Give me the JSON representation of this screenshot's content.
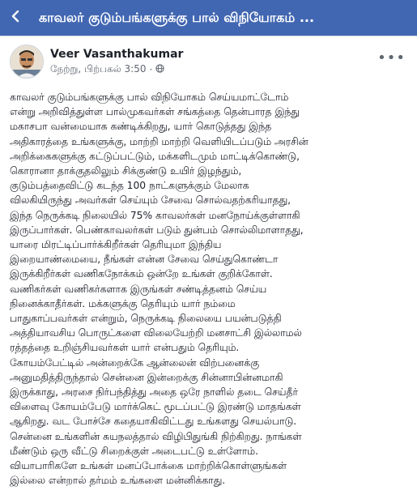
{
  "topbar": {
    "back_icon": "arrow-left-icon",
    "title": "காவலர் குடும்பங்களுக்கு பால் விநியோகம் ..."
  },
  "post": {
    "author": "Veer Vasanthakumar",
    "time": "நேற்று, பிற்பகல் 3:50",
    "separator": "·",
    "privacy_icon": "globe-icon",
    "more_icon": "more-dots-icon",
    "more_label": "•••",
    "lines": [
      "காவலர் குடும்பங்களுக்கு பால் விநியோகம் செய்யமாட்டோம்",
      "என்று அறிவித்துள்ள பால்முகவர்கள் சங்கத்தை தென்பாரத இந்து",
      "மகாசபா வன்மையாக கண்டிக்கிறது, யார் கொடுத்தது இந்த",
      "அதிகாரத்தை உங்களுக்கு, மாற்றி மாற்றி வெளியிடப்படும் அரசின்",
      "அறிக்கைகளுக்கு கட்டுப்பட்டும், மக்களிடமும் மாட்டிக்கொண்டு,",
      "கொரானா தாக்குதலிலும் சிக்குண்டு உயிர் இழந்தும்,",
      "குடும்பத்தைவிட்டு கடந்த 100 நாட்களுக்கும் மேலாக",
      "விலகியிருந்து அவர்கள் செய்யும் சேவை சொல்வதற்கரியாதது,",
      "இந்த நெருக்கடி நிலையில் 75% காவலர்கள் மனநோய்க்குள்ளாகி",
      "இருப்பார்கள். பெண்காவலர்கள் படும் துன்பம் சொல்லிமாளாதது,",
      "யாரை மிரட்டிப்பார்க்கிறீர்கள் தெரியுமா இந்திய",
      "இறையாண்மையை, நீங்கள் என்ன சேவை செய்துகொண்டா",
      "இருக்கிறீர்கள் வணிகநோக்கம் ஒன்றே உங்கள் குறிக்கோள்.",
      "வணிகர்கள் வணிகர்களாக இருங்கள் சண்டித்தனம் செய்ய",
      "நினைக்காதீர்கள். மக்களுக்கு தெரியும் யார் நம்மை",
      "பாதுகாப்பவர்கள் என்றும், நெருக்கடி நிலையை பயன்படுத்தி",
      "அத்தியாவசிய பொருட்களை விலையேற்றி மனசாட்சி இல்லாமல்",
      "ரத்தத்தை உறிஞ்சியவர்கள் யார் என்பதும் தெரியும்.",
      "கோயம்பேட்டில் அன்றைக்கே ஆன்லைன் விற்பனைக்கு",
      "அனுமதித்திருந்தால் சென்னை இன்றைக்கு சின்னாபின்னமாகி",
      "இருக்காது, அரசை நிர்பந்தித்து அதை ஒரே நாளில் தடை செய்தீர்",
      "விளைவு கோயம்பேடு மார்க்கெட் மூடப்பட்டு இரண்டு மாதங்கள்",
      "ஆகிறது. வட போச்சே கதையாகிவிட்டது உங்களது செயல்பாடு.",
      "சென்னை உங்களின் சுயநலத்தால் விழிபிதுங்கி நிற்கிறது. நாங்கள்",
      "மீண்டும் ஒரு வீட்டு சிறைக்குள் அடைபட்டு உள்ளோம்.",
      "வியாபாரிகளே உங்கள் மனப்போக்கை மாற்றிக்கொள்ளுங்கள்",
      "இல்லை என்றால் தர்மம் உங்களை மன்னிக்காது."
    ]
  }
}
